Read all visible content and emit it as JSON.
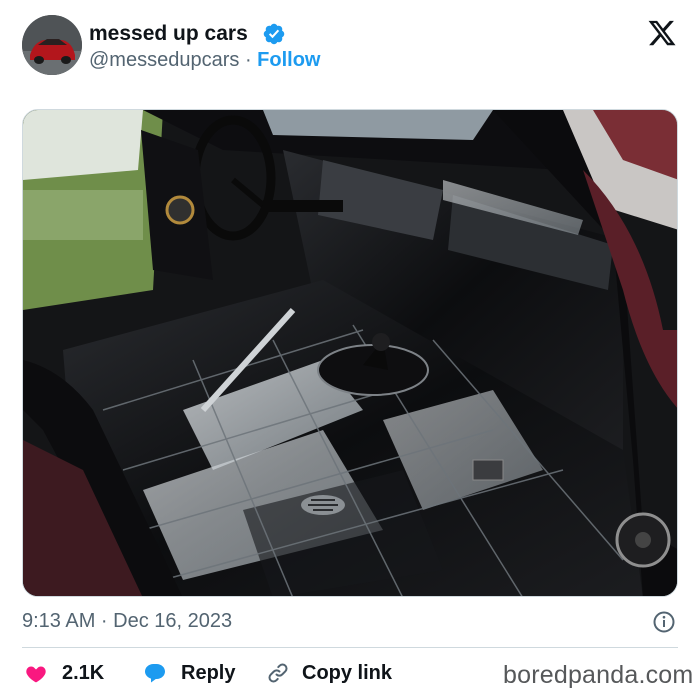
{
  "author": {
    "display_name": "messed up cars",
    "handle": "@messedupcars",
    "separator": "·",
    "follow_label": "Follow",
    "verified": true
  },
  "platform_icon": "x-logo-icon",
  "media": {
    "subject": "car interior with black tiled floor and dashboard",
    "icon": "photo"
  },
  "timestamp": "9:13 AM · Dec 16, 2023",
  "actions": {
    "likes_count": "2.1K",
    "reply_label": "Reply",
    "copy_link_label": "Copy link"
  },
  "watermark": "boredpanda.com",
  "colors": {
    "accent": "#1d9bf0",
    "like": "#f91880",
    "secondary_text": "#536471"
  }
}
